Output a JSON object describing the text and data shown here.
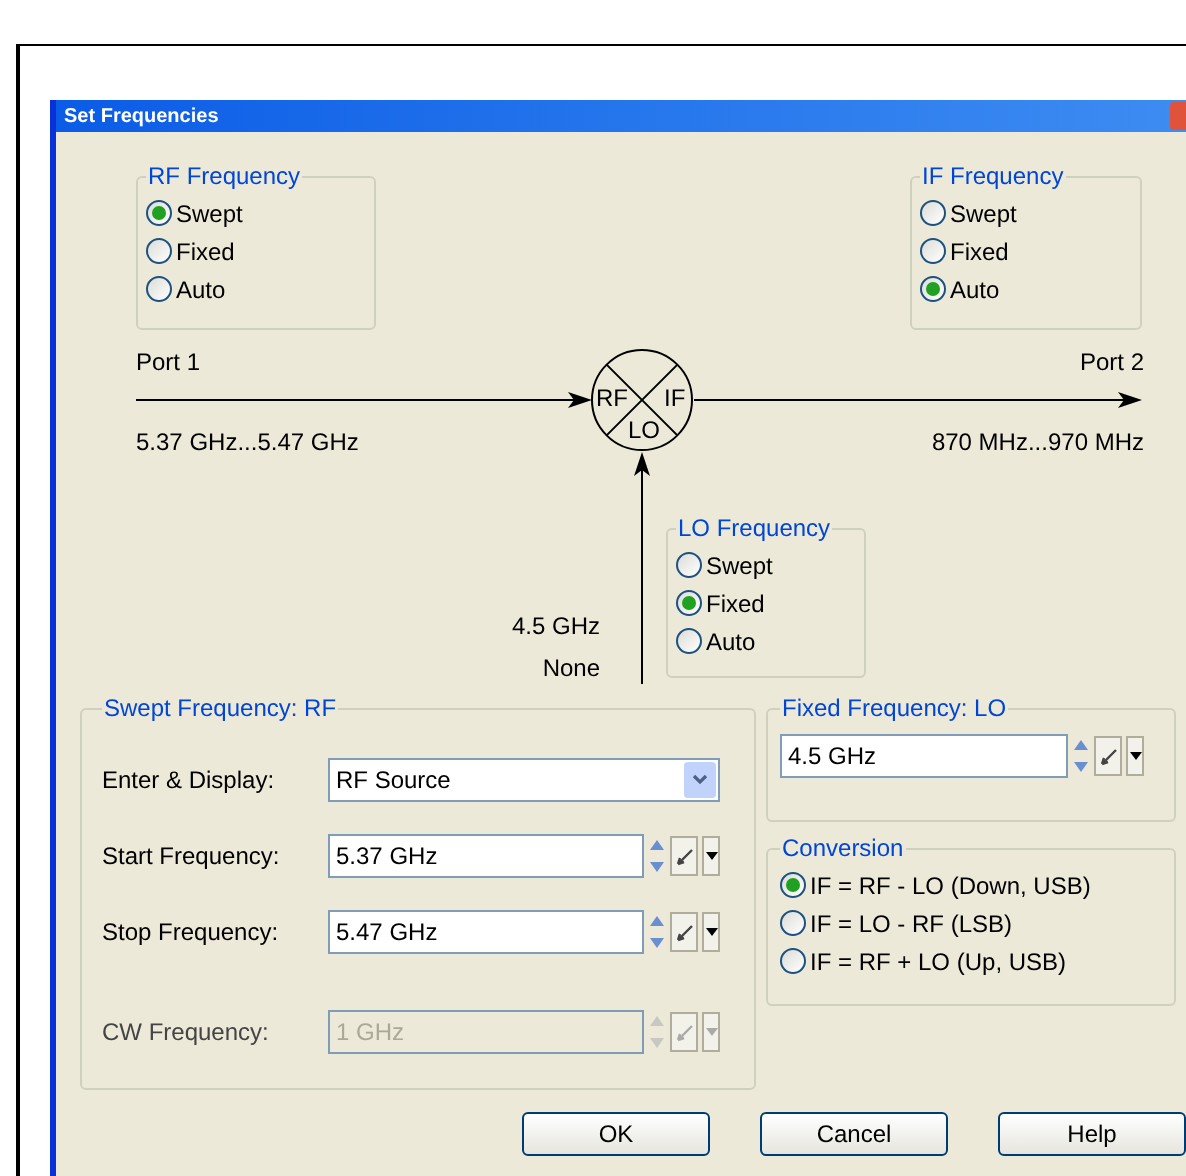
{
  "window": {
    "title": "Set Frequencies"
  },
  "rf_frequency": {
    "title": "RF Frequency",
    "options": [
      {
        "label": "Swept",
        "selected": true
      },
      {
        "label": "Fixed",
        "selected": false
      },
      {
        "label": "Auto",
        "selected": false
      }
    ]
  },
  "if_frequency": {
    "title": "IF Frequency",
    "options": [
      {
        "label": "Swept",
        "selected": false
      },
      {
        "label": "Fixed",
        "selected": false
      },
      {
        "label": "Auto",
        "selected": true
      }
    ]
  },
  "diagram": {
    "port_1": "Port 1",
    "rf_range": "5.37 GHz...5.47 GHz",
    "port_2": "Port 2",
    "if_range": "870 MHz...970 MHz",
    "mixer": {
      "rf": "RF",
      "if": "IF",
      "lo": "LO"
    },
    "lo_value": "4.5 GHz",
    "lo_source": "None"
  },
  "lo_frequency": {
    "title": "LO Frequency",
    "options": [
      {
        "label": "Swept",
        "selected": false
      },
      {
        "label": "Fixed",
        "selected": true
      },
      {
        "label": "Auto",
        "selected": false
      }
    ]
  },
  "swept_frequency": {
    "title": "Swept Frequency: RF",
    "rows": [
      {
        "kind": "dropdown",
        "label": "Enter & Display:",
        "value": "RF Source"
      },
      {
        "kind": "spin",
        "label": "Start Frequency:",
        "value": "5.37 GHz",
        "disabled": false
      },
      {
        "kind": "spin",
        "label": "Stop Frequency:",
        "value": "5.47 GHz",
        "disabled": false
      },
      {
        "kind": "spin",
        "label": "CW Frequency:",
        "value": "1 GHz",
        "disabled": true
      }
    ]
  },
  "fixed_frequency": {
    "title": "Fixed Frequency: LO",
    "value": "4.5 GHz",
    "disabled": false
  },
  "conversion": {
    "title": "Conversion",
    "options": [
      {
        "label": "IF = RF - LO (Down, USB)",
        "selected": true
      },
      {
        "label": "IF = LO - RF (LSB)",
        "selected": false
      },
      {
        "label": "IF = RF + LO (Up, USB)",
        "selected": false
      }
    ]
  },
  "buttons": [
    "OK",
    "Cancel",
    "Help"
  ]
}
